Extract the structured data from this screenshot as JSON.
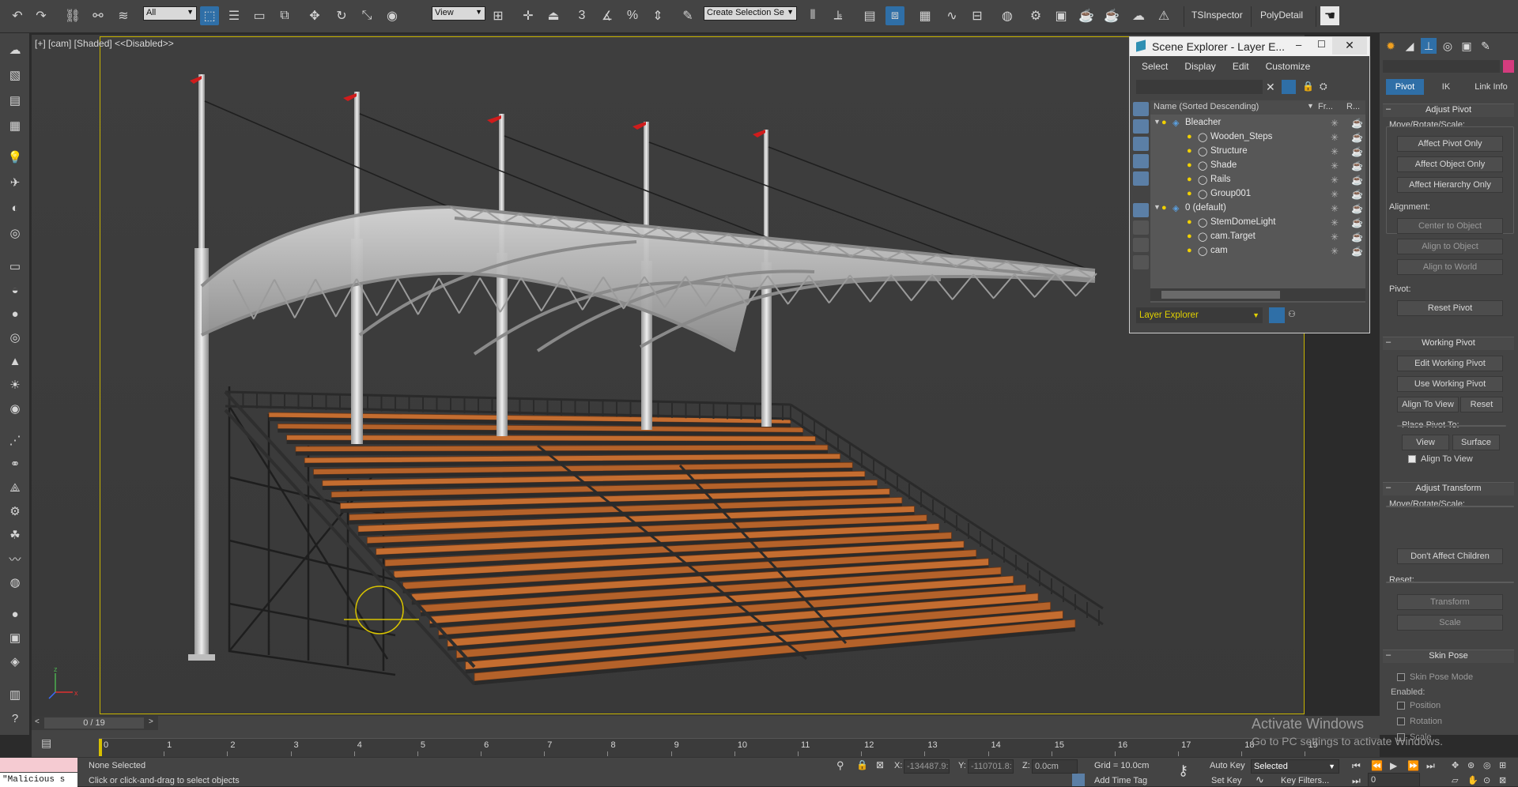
{
  "toolbar": {
    "selection_filter": "All",
    "ref_coord": "View",
    "selection_set": "Create Selection Se",
    "snap_angle": "3",
    "plugin_1": "TSInspector",
    "plugin_2": "PolyDetail"
  },
  "viewport": {
    "label": "[+] [cam] [Shaded] <<Disabled>>"
  },
  "scene_explorer": {
    "title": "Scene Explorer - Layer E...",
    "menu": [
      "Select",
      "Display",
      "Edit",
      "Customize"
    ],
    "columns": {
      "name": "Name (Sorted Descending)",
      "frozen": "Fr...",
      "render": "R..."
    },
    "rows": [
      {
        "name": "Bleacher",
        "level": 0
      },
      {
        "name": "Wooden_Steps",
        "level": 1
      },
      {
        "name": "Structure",
        "level": 1
      },
      {
        "name": "Shade",
        "level": 1
      },
      {
        "name": "Rails",
        "level": 1
      },
      {
        "name": "Group001",
        "level": 1
      },
      {
        "name": "0 (default)",
        "level": 0
      },
      {
        "name": "StemDomeLight",
        "level": 1
      },
      {
        "name": "cam.Target",
        "level": 1
      },
      {
        "name": "cam",
        "level": 1
      }
    ],
    "explorer_type": "Layer Explorer"
  },
  "command_panel": {
    "tabs": [
      "Pivot",
      "IK",
      "Link Info"
    ],
    "adjust_pivot": {
      "title": "Adjust Pivot",
      "move_label": "Move/Rotate/Scale:",
      "affect_pivot": "Affect Pivot Only",
      "affect_object": "Affect Object Only",
      "affect_hierarchy": "Affect Hierarchy Only",
      "alignment_label": "Alignment:",
      "center_to_object": "Center to Object",
      "align_to_object": "Align to Object",
      "align_to_world": "Align to World",
      "pivot_label": "Pivot:",
      "reset_pivot": "Reset Pivot"
    },
    "working_pivot": {
      "title": "Working Pivot",
      "edit": "Edit Working Pivot",
      "use": "Use Working Pivot",
      "align_to_view": "Align To View",
      "reset": "Reset",
      "place_label": "Place Pivot To:",
      "view": "View",
      "surface": "Surface",
      "align_chk": "Align To View"
    },
    "adjust_transform": {
      "title": "Adjust Transform",
      "move_label": "Move/Rotate/Scale:",
      "dont_affect": "Don't Affect Children",
      "reset_label": "Reset:",
      "transform": "Transform",
      "scale": "Scale"
    },
    "skin_pose": {
      "title": "Skin Pose",
      "mode": "Skin Pose Mode",
      "enabled_label": "Enabled:",
      "position": "Position",
      "rotation": "Rotation",
      "scale": "Scale"
    }
  },
  "timeline": {
    "frame_counter": "0 / 19",
    "ticks": [
      "0",
      "1",
      "2",
      "3",
      "4",
      "5",
      "6",
      "7",
      "8",
      "9",
      "10",
      "11",
      "12",
      "13",
      "14",
      "15",
      "16",
      "17",
      "18",
      "19"
    ]
  },
  "status": {
    "maxscript": "\"Malicious s",
    "selection": "None Selected",
    "prompt": "Click or click-and-drag to select objects",
    "x_label": "X:",
    "x_value": "-134487.9:",
    "y_label": "Y:",
    "y_value": "-110701.8:",
    "z_label": "Z:",
    "z_value": "0.0cm",
    "grid": "Grid = 10.0cm",
    "add_time_tag": "Add Time Tag",
    "auto_key": "Auto Key",
    "set_key": "Set Key",
    "key_mode": "Selected",
    "key_filters": "Key Filters...",
    "frame": "0"
  },
  "watermark": {
    "line1": "Activate Windows",
    "line2": "Go to PC settings to activate Windows."
  }
}
